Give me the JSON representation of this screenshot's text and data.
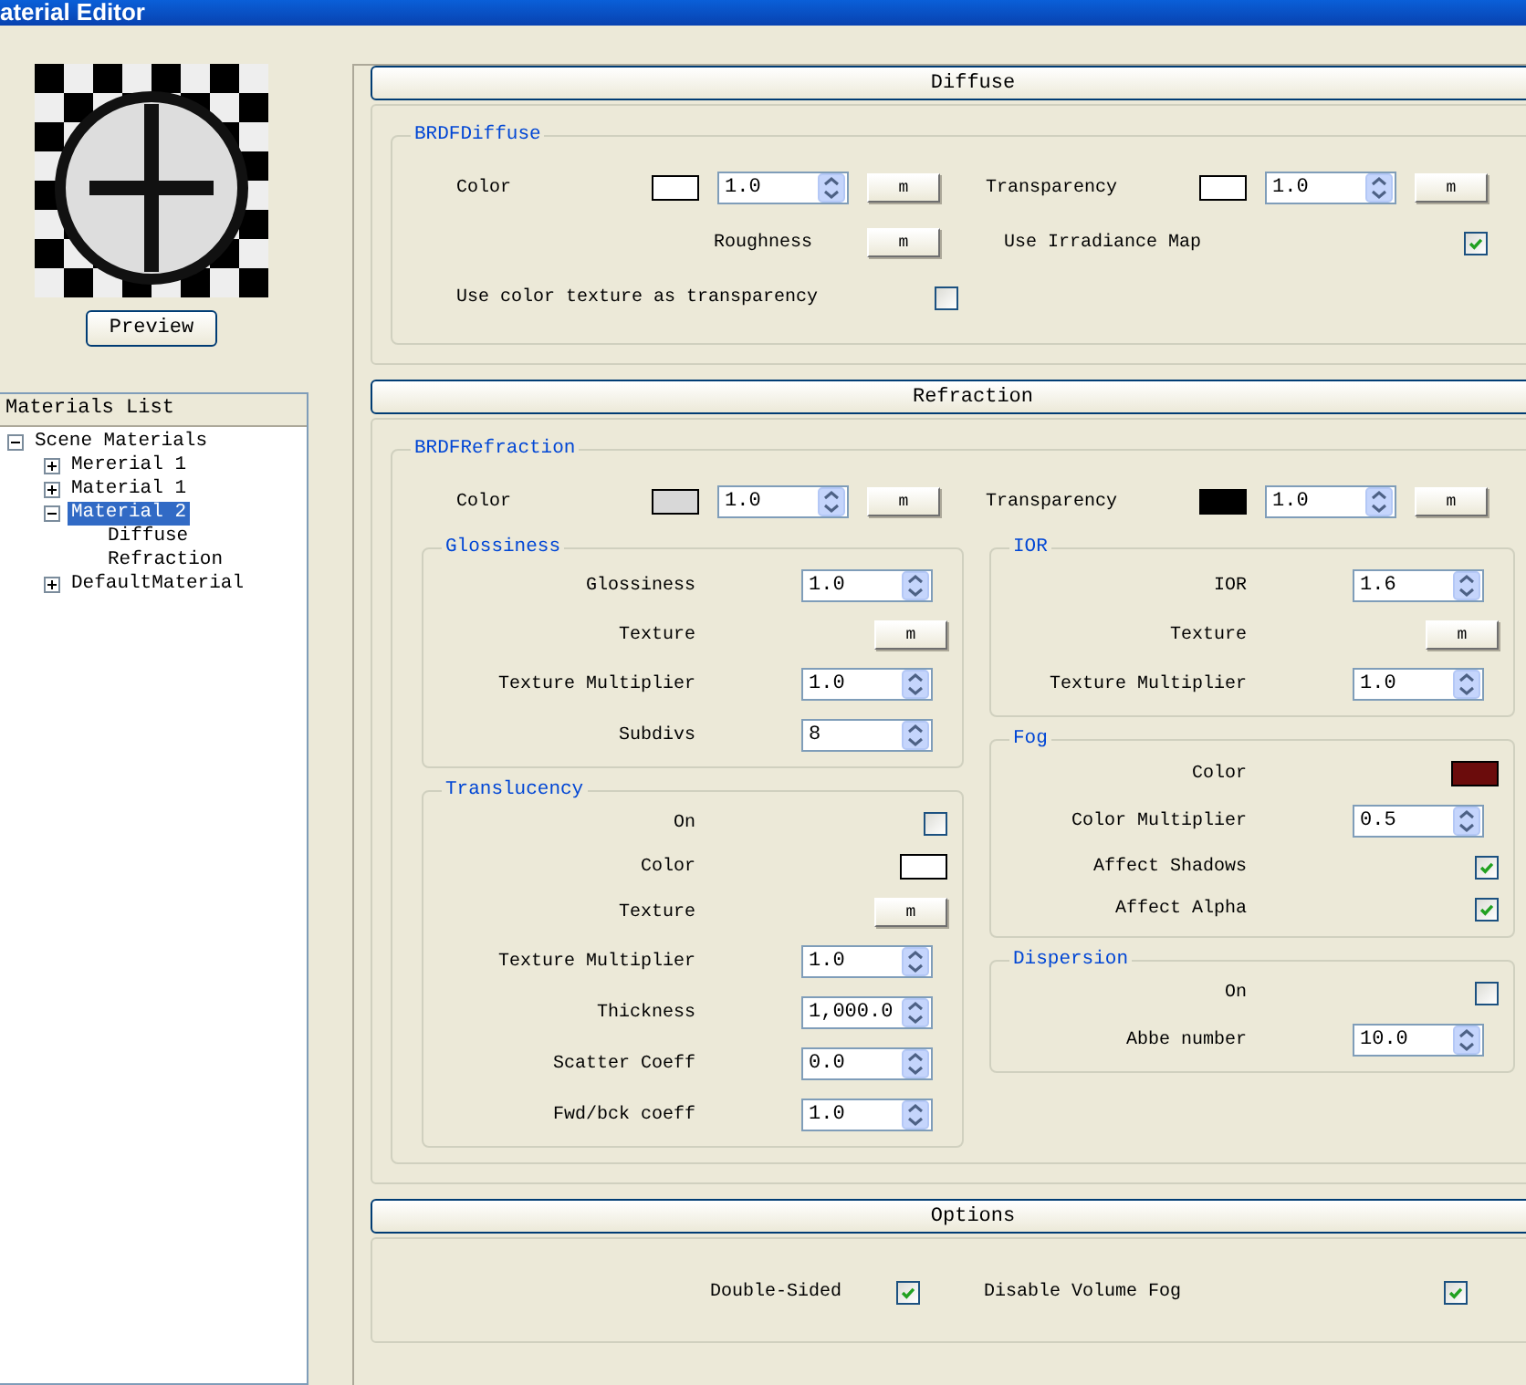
{
  "window": {
    "title": "aterial Editor"
  },
  "preview": {
    "button": "Preview"
  },
  "materials_list": {
    "header": "Materials List",
    "tree": [
      {
        "label": "Scene Materials",
        "expanded": true,
        "selected": false,
        "children": [
          {
            "label": "Mererial 1",
            "expanded": false,
            "selected": false
          },
          {
            "label": "Material 1",
            "expanded": false,
            "selected": false
          },
          {
            "label": "Material 2",
            "expanded": true,
            "selected": true,
            "children": [
              {
                "label": "Diffuse",
                "selected": false
              },
              {
                "label": "Refraction",
                "selected": false
              }
            ]
          },
          {
            "label": "DefaultMaterial",
            "expanded": false,
            "selected": false
          }
        ]
      }
    ]
  },
  "sections": [
    {
      "title": "Diffuse",
      "kind": "rows",
      "group": "BRDFDiffuse",
      "rows": [
        {
          "fields": [
            {
              "label": "Color",
              "controls": [
                {
                  "kind": "swatch",
                  "color": "#ffffff"
                },
                {
                  "kind": "spin",
                  "value": "1.0"
                },
                {
                  "kind": "map",
                  "label": "m"
                }
              ]
            },
            {
              "label": "Transparency",
              "controls": [
                {
                  "kind": "swatch",
                  "color": "#ffffff"
                },
                {
                  "kind": "spin",
                  "value": "1.0"
                },
                {
                  "kind": "map",
                  "label": "m"
                }
              ]
            }
          ]
        },
        {
          "fields": [
            {
              "label": "Roughness",
              "controls": [
                {
                  "kind": "map",
                  "label": "m"
                }
              ]
            },
            {
              "label": "Use Irradiance Map",
              "controls": [
                {
                  "kind": "check",
                  "checked": true
                }
              ]
            }
          ]
        },
        {
          "fields": [
            {
              "label": "Use color texture as transparency",
              "controls": [
                {
                  "kind": "check",
                  "checked": false
                }
              ]
            }
          ]
        }
      ]
    },
    {
      "title": "Refraction",
      "kind": "nested",
      "group": "BRDFRefraction",
      "rows": [
        {
          "fields": [
            {
              "label": "Color",
              "controls": [
                {
                  "kind": "swatch",
                  "color": "#d8d8d8"
                },
                {
                  "kind": "spin",
                  "value": "1.0"
                },
                {
                  "kind": "map",
                  "label": "m"
                }
              ]
            },
            {
              "label": "Transparency",
              "controls": [
                {
                  "kind": "swatch",
                  "color": "#000000"
                },
                {
                  "kind": "spin",
                  "value": "1.0"
                },
                {
                  "kind": "map",
                  "label": "m"
                }
              ]
            }
          ]
        }
      ],
      "columns": [
        {
          "groups": [
            {
              "title": "Glossiness",
              "fields": [
                {
                  "label": "Glossiness",
                  "controls": [
                    {
                      "kind": "spin",
                      "value": "1.0"
                    }
                  ]
                },
                {
                  "label": "Texture",
                  "controls": [
                    {
                      "kind": "map",
                      "label": "m"
                    }
                  ]
                },
                {
                  "label": "Texture Multiplier",
                  "controls": [
                    {
                      "kind": "spin",
                      "value": "1.0"
                    }
                  ]
                },
                {
                  "label": "Subdivs",
                  "controls": [
                    {
                      "kind": "spin",
                      "value": "8"
                    }
                  ]
                }
              ]
            },
            {
              "title": "Translucency",
              "fields": [
                {
                  "label": "On",
                  "controls": [
                    {
                      "kind": "check",
                      "checked": false
                    }
                  ]
                },
                {
                  "label": "Color",
                  "controls": [
                    {
                      "kind": "swatch",
                      "color": "#ffffff"
                    }
                  ]
                },
                {
                  "label": "Texture",
                  "controls": [
                    {
                      "kind": "map",
                      "label": "m"
                    }
                  ]
                },
                {
                  "label": "Texture Multiplier",
                  "controls": [
                    {
                      "kind": "spin",
                      "value": "1.0"
                    }
                  ]
                },
                {
                  "label": "Thickness",
                  "controls": [
                    {
                      "kind": "spin",
                      "value": "1,000.0"
                    }
                  ]
                },
                {
                  "label": "Scatter Coeff",
                  "controls": [
                    {
                      "kind": "spin",
                      "value": "0.0"
                    }
                  ]
                },
                {
                  "label": "Fwd/bck coeff",
                  "controls": [
                    {
                      "kind": "spin",
                      "value": "1.0"
                    }
                  ]
                }
              ]
            }
          ]
        },
        {
          "groups": [
            {
              "title": "IOR",
              "fields": [
                {
                  "label": "IOR",
                  "controls": [
                    {
                      "kind": "spin",
                      "value": "1.6"
                    }
                  ]
                },
                {
                  "label": "Texture",
                  "controls": [
                    {
                      "kind": "map",
                      "label": "m"
                    }
                  ]
                },
                {
                  "label": "Texture Multiplier",
                  "controls": [
                    {
                      "kind": "spin",
                      "value": "1.0"
                    }
                  ]
                }
              ]
            },
            {
              "title": "Fog",
              "fields": [
                {
                  "label": "Color",
                  "controls": [
                    {
                      "kind": "swatch",
                      "color": "#6b0c0c"
                    }
                  ]
                },
                {
                  "label": "Color Multiplier",
                  "controls": [
                    {
                      "kind": "spin",
                      "value": "0.5"
                    }
                  ]
                },
                {
                  "label": "Affect Shadows",
                  "controls": [
                    {
                      "kind": "check",
                      "checked": true
                    }
                  ]
                },
                {
                  "label": "Affect Alpha",
                  "controls": [
                    {
                      "kind": "check",
                      "checked": true
                    }
                  ]
                }
              ]
            },
            {
              "title": "Dispersion",
              "fields": [
                {
                  "label": "On",
                  "controls": [
                    {
                      "kind": "check",
                      "checked": false
                    }
                  ]
                },
                {
                  "label": "Abbe number",
                  "controls": [
                    {
                      "kind": "spin",
                      "value": "10.0"
                    }
                  ]
                }
              ]
            }
          ]
        }
      ]
    },
    {
      "title": "Options",
      "kind": "plain",
      "rows": [
        {
          "fields": [
            {
              "label": "Double-Sided",
              "controls": [
                {
                  "kind": "check",
                  "checked": true
                }
              ]
            },
            {
              "label": "Disable Volume Fog",
              "controls": [
                {
                  "kind": "check",
                  "checked": true
                }
              ]
            }
          ]
        }
      ]
    }
  ]
}
